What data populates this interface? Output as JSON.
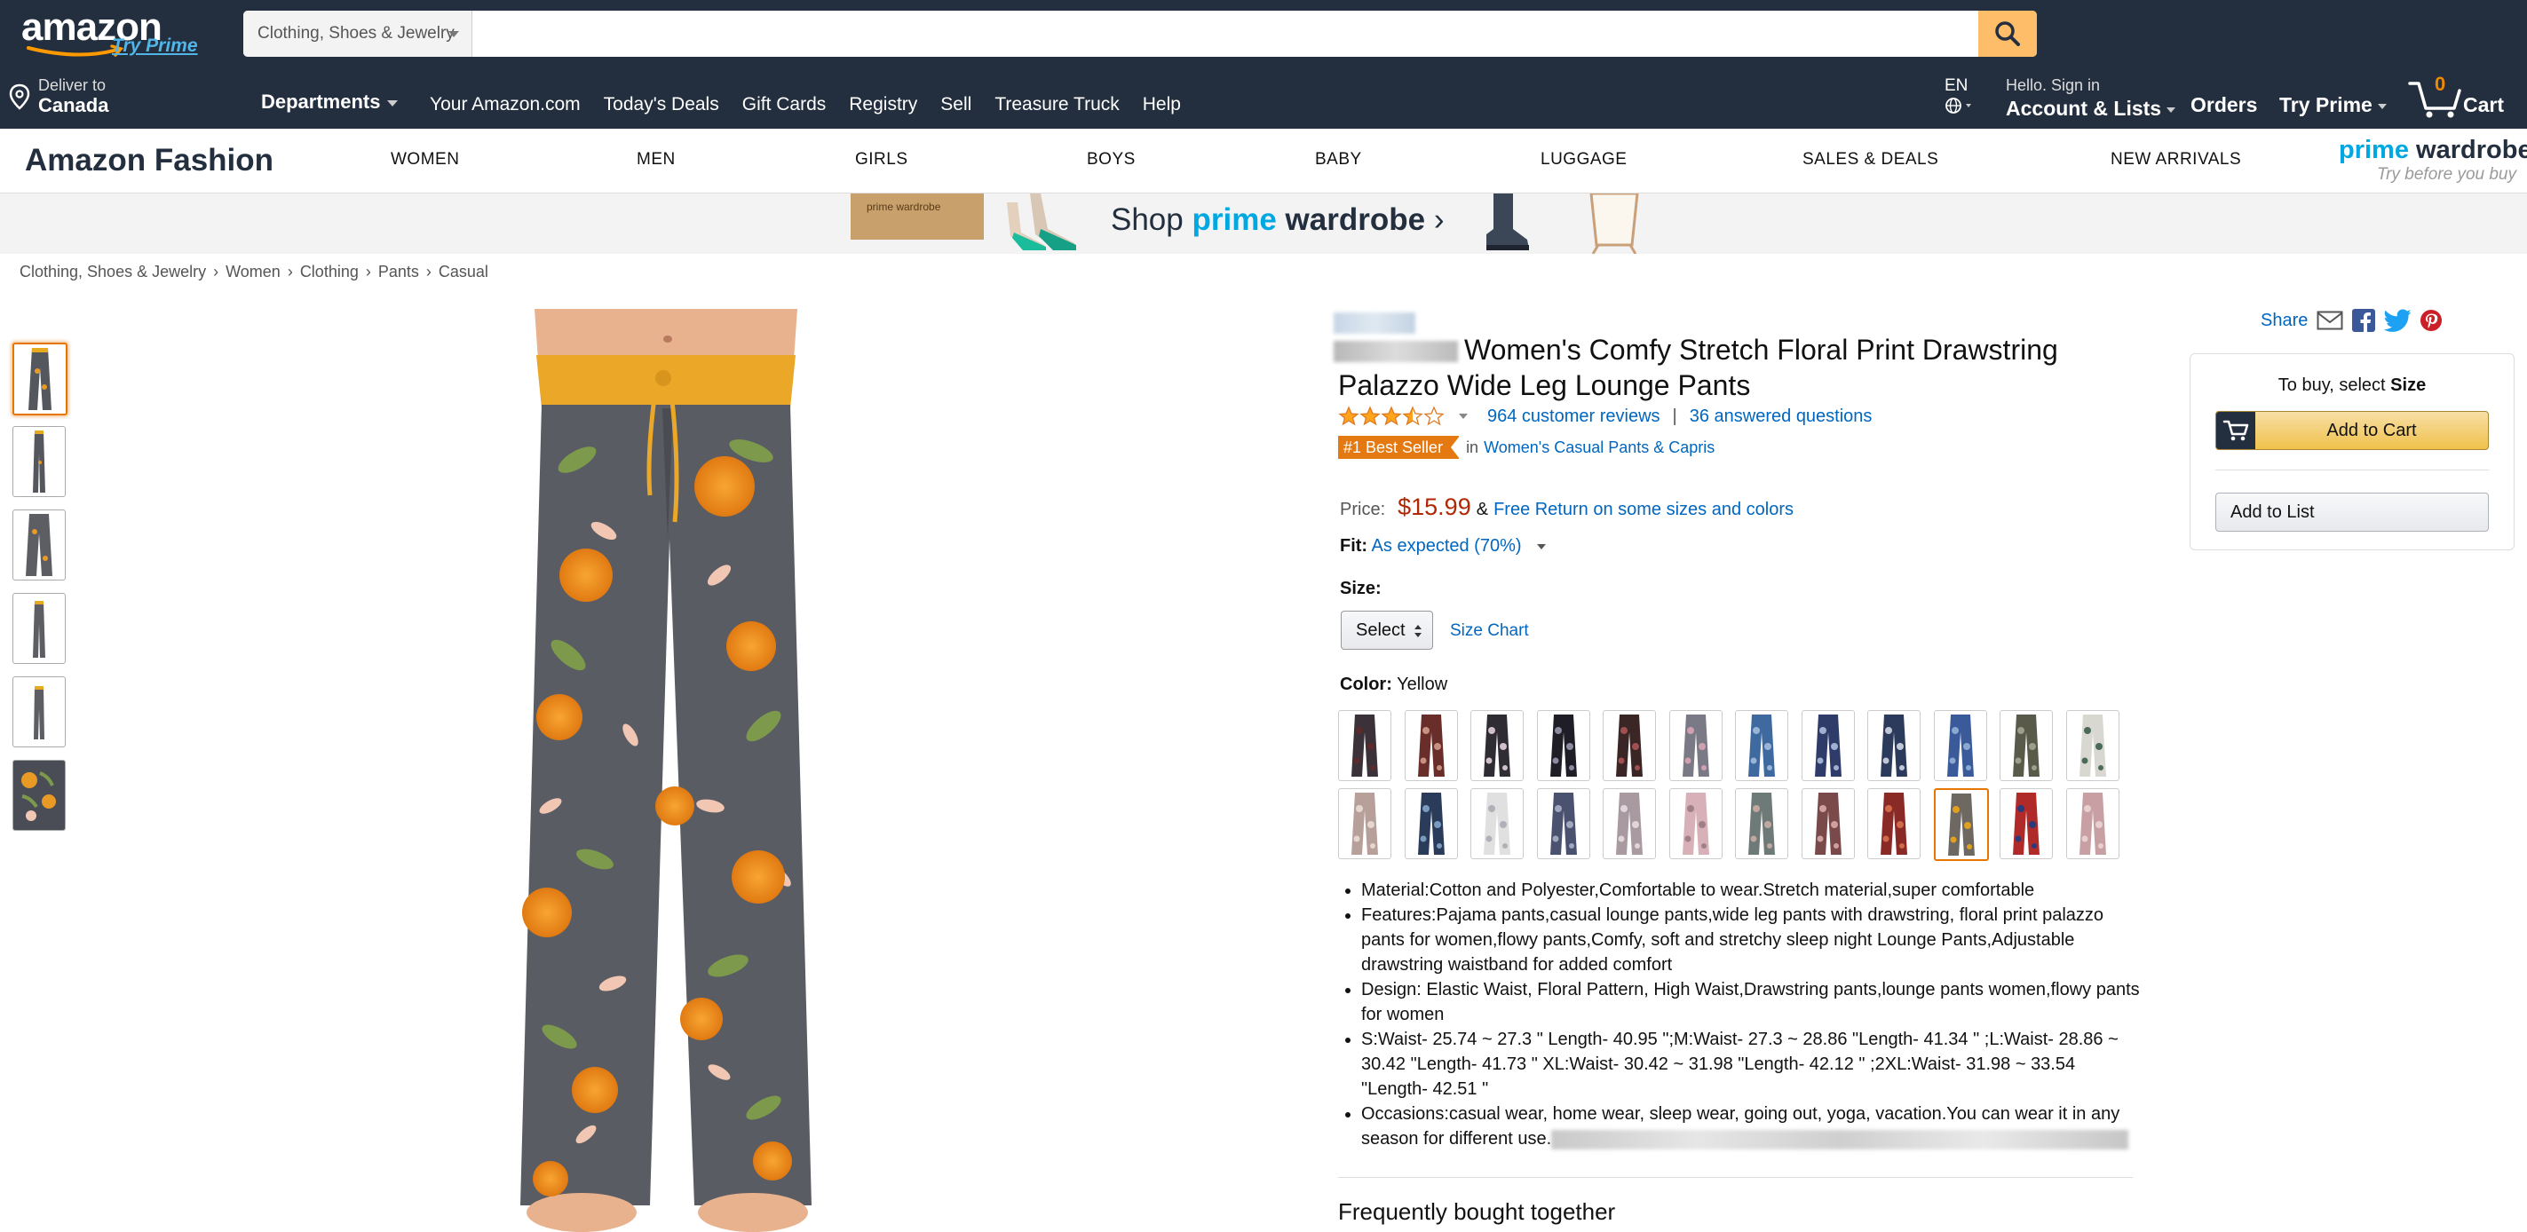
{
  "header": {
    "logo_text": "amazon",
    "logo_tagline": "Try Prime",
    "search": {
      "category": "Clothing, Shoes & Jewelry",
      "value": "",
      "placeholder": ""
    },
    "deliver": {
      "line1": "Deliver to",
      "line2": "Canada"
    },
    "departments_label": "Departments",
    "nav_links": [
      "Your Amazon.com",
      "Today's Deals",
      "Gift Cards",
      "Registry",
      "Sell",
      "Treasure Truck",
      "Help"
    ],
    "language": "EN",
    "account": {
      "line1": "Hello. Sign in",
      "line2": "Account & Lists"
    },
    "orders": "Orders",
    "try_prime": "Try Prime",
    "cart": {
      "count": "0",
      "label": "Cart"
    }
  },
  "fashion_nav": {
    "title": "Amazon Fashion",
    "links": [
      "WOMEN",
      "MEN",
      "GIRLS",
      "BOYS",
      "BABY",
      "LUGGAGE",
      "SALES & DEALS",
      "NEW ARRIVALS"
    ],
    "prime_wardrobe_a": "prime",
    "prime_wardrobe_b": "wardrobe",
    "prime_wardrobe_tagline": "Try before you buy"
  },
  "banner": {
    "box_text": "prime wardrobe",
    "shop": "Shop",
    "prime": "prime",
    "wardrobe": "wardrobe",
    "arrow": "›"
  },
  "breadcrumb": [
    "Clothing, Shoes & Jewelry",
    "Women",
    "Clothing",
    "Pants",
    "Casual"
  ],
  "product": {
    "title": "Women's Comfy Stretch Floral Print Drawstring Palazzo Wide Leg Lounge Pants",
    "rating": 3.5,
    "reviews": "964 customer reviews",
    "answered": "36 answered questions",
    "best_seller_badge": "#1 Best Seller",
    "in_text": "in",
    "best_seller_category": "Women's Casual Pants & Capris",
    "price_label": "Price:",
    "price": "$15.99",
    "amp": "&",
    "free_return": "Free Return on some sizes and colors",
    "fit_label": "Fit:",
    "fit_value": "As expected (70%)",
    "size_label": "Size:",
    "size_select": "Select",
    "size_chart": "Size Chart",
    "color_label": "Color:",
    "color_value": "Yellow",
    "bullets": [
      "Material:Cotton and Polyester,Comfortable to wear.Stretch material,super comfortable",
      "Features:Pajama pants,casual lounge pants,wide leg pants with drawstring, floral print palazzo pants for women,flowy pants,Comfy, soft and stretchy sleep night Lounge Pants,Adjustable drawstring waistband for added comfort",
      "Design: Elastic Waist, Floral Pattern, High Waist,Drawstring pants,lounge pants women,flowy pants for women",
      "S:Waist- 25.74 ~ 27.3 \" Length- 40.95 \";M:Waist- 27.3 ~ 28.86 \"Length- 41.34 \" ;L:Waist- 28.86 ~ 30.42 \"Length- 41.73 \" XL:Waist- 30.42 ~ 31.98 \"Length- 42.12 \" ;2XL:Waist- 31.98 ~ 33.54 \"Length- 42.51 \"",
      "Occasions:casual wear, home wear, sleep wear, going out, yoga, vacation.You can wear it in any season for different use."
    ],
    "frequently_bought": "Frequently bought together"
  },
  "buybox": {
    "share": "Share",
    "hint_prefix": "To buy, select",
    "hint_bold": "Size",
    "add_to_cart": "Add to Cart",
    "add_to_list": "Add to List"
  },
  "colors": {
    "accent": "#e47911",
    "price": "#b12704",
    "link": "#0066c0",
    "nav_bg": "#232f3e",
    "button": "#f0c14b"
  },
  "swatches": [
    [
      "#3a3238",
      "#5c2a2a"
    ],
    [
      "#6a2e2a",
      "#c89080"
    ],
    [
      "#2f2c34",
      "#d0c0c8"
    ],
    [
      "#1f1e26",
      "#8a8aa0"
    ],
    [
      "#3a2624",
      "#a05050"
    ],
    [
      "#7a7a86",
      "#d0a0b0"
    ],
    [
      "#3f6aa0",
      "#9ab4d8"
    ],
    [
      "#2f3c6a",
      "#a0b0d0"
    ],
    [
      "#2c3a5c",
      "#c0c8d8"
    ],
    [
      "#3a5a9a",
      "#8aa8d0"
    ],
    [
      "#5a5a4a",
      "#9aa08a"
    ],
    [
      "#d8d8d0",
      "#4a6a5a"
    ],
    [
      "#b8a09a",
      "#e6d6d0"
    ],
    [
      "#2a3c5a",
      "#7a9ac0"
    ],
    [
      "#e0e0e0",
      "#b0b0b8"
    ],
    [
      "#4a5270",
      "#a0a8c0"
    ],
    [
      "#a89aa0",
      "#e0d6d8"
    ],
    [
      "#d8b0b8",
      "#a08088"
    ],
    [
      "#6e7a78",
      "#c0a8a0"
    ],
    [
      "#7a4a4a",
      "#d0a0a0"
    ],
    [
      "#8a2a26",
      "#d06a4a"
    ],
    [
      "#6e6862",
      "#e0a020"
    ],
    [
      "#b02a2a",
      "#2a3a7a"
    ],
    [
      "#c8a0a4",
      "#e8d0d0"
    ]
  ],
  "selected_swatch": 21
}
